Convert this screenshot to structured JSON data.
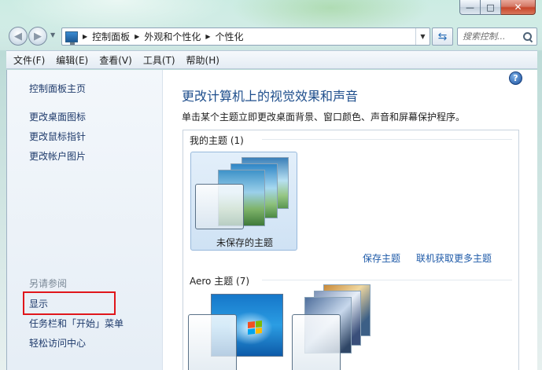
{
  "window": {
    "minimize_glyph": "—",
    "maximize_glyph": "□",
    "close_glyph": "✕"
  },
  "navigation": {
    "back_glyph": "◀",
    "forward_glyph": "▶",
    "breadcrumbs": [
      "控制面板",
      "外观和个性化",
      "个性化"
    ],
    "search_placeholder": "搜索控制...",
    "refresh_icon": "refresh-icon"
  },
  "menu": {
    "items": [
      "文件(F)",
      "编辑(E)",
      "查看(V)",
      "工具(T)",
      "帮助(H)"
    ]
  },
  "sidebar": {
    "home_link": "控制面板主页",
    "links": [
      "更改桌面图标",
      "更改鼠标指针",
      "更改帐户图片"
    ],
    "see_also_heading": "另请参阅",
    "see_also_links": [
      "显示",
      "任务栏和「开始」菜单",
      "轻松访问中心"
    ],
    "highlight_color": "#e0161b"
  },
  "main": {
    "help_glyph": "?",
    "title": "更改计算机上的视觉效果和声音",
    "subtitle": "单击某个主题立即更改桌面背景、窗口颜色、声音和屏幕保护程序。",
    "my_themes_label": "我的主题 (1)",
    "my_theme_name": "未保存的主题",
    "save_theme_link": "保存主题",
    "online_themes_link": "联机获取更多主题",
    "aero_themes_label": "Aero 主题 (7)"
  },
  "colors": {
    "link": "#1e5aa8",
    "title": "#1e4e8c",
    "selected_card": "#cfe2f4"
  }
}
